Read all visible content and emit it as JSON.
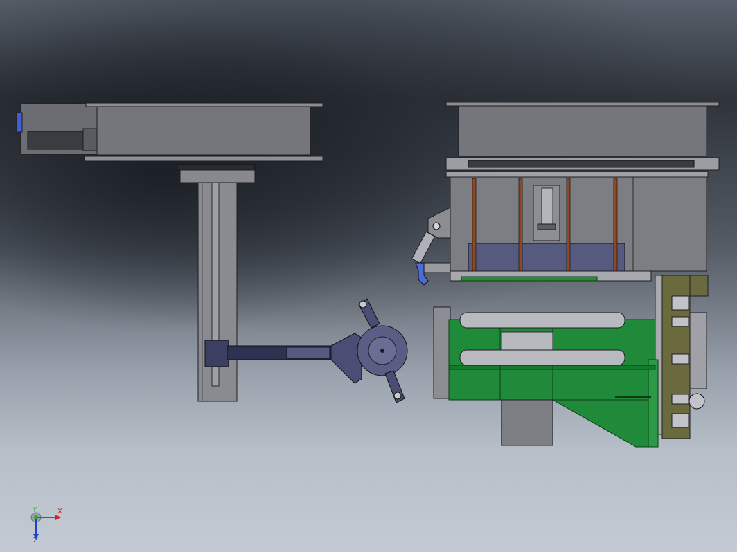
{
  "viewport": {
    "background_top": "#2f343b",
    "background_bottom": "#c3cad3",
    "part_colors": {
      "steel": "#7a7a7e",
      "steel_light": "#9b9ca0",
      "steel_dark": "#3e3f43",
      "purple": "#575a80",
      "purple_dark": "#34365a",
      "green": "#1f8a39",
      "green_dark": "#0f5e22",
      "olive": "#6b6a3e",
      "copper": "#8a4a28",
      "blue": "#3e5fd8"
    }
  },
  "triad": {
    "x_label": "X",
    "y_label": "Y",
    "z_label": "Z",
    "x_color": "#d82020",
    "y_color": "#20b020",
    "z_color": "#2040d0"
  }
}
